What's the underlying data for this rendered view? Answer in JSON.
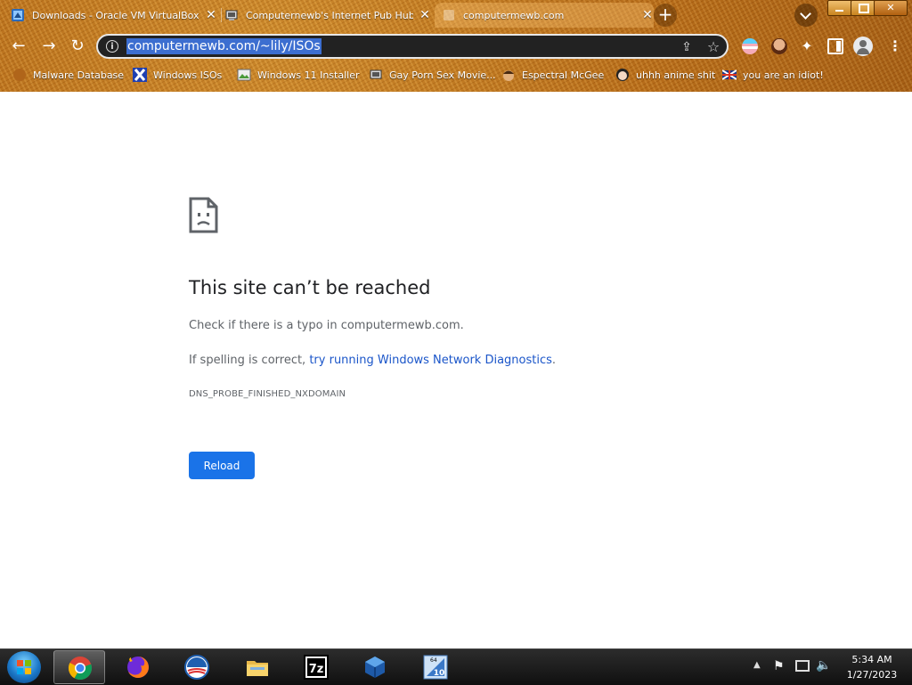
{
  "tabs": [
    {
      "title": "Downloads - Oracle VM VirtualBox",
      "close": "✕"
    },
    {
      "title": "Computernewb's Internet Pub Hub",
      "close": "✕"
    },
    {
      "title": "computermewb.com",
      "close": "✕"
    }
  ],
  "new_tab_label": "+",
  "toolbar": {
    "back": "←",
    "forward": "→",
    "reload": "↻",
    "url": "computermewb.com/~lily/ISOs",
    "site_info": "i",
    "share": "⇪",
    "star": "☆",
    "extensions": "✦",
    "menu": "⋮"
  },
  "bookmarks": [
    {
      "label": "Malware Database",
      "icon": "chrome-logo"
    },
    {
      "label": "Windows ISOs",
      "icon": "x-logo"
    },
    {
      "label": "Windows 11 Installer",
      "icon": "image-icon"
    },
    {
      "label": "Gay Porn Sex Movie...",
      "icon": "pub-hub-icon"
    },
    {
      "label": "Espectral McGee",
      "icon": "face-icon"
    },
    {
      "label": "uhhh anime shit",
      "icon": "anime-icon"
    },
    {
      "label": "you are an idiot!",
      "icon": "uk-flag-icon"
    }
  ],
  "error": {
    "title": "This site can’t be reached",
    "line1": "Check if there is a typo in computermewb.com.",
    "line2_prefix": "If spelling is correct, ",
    "line2_link": "try running Windows Network Diagnostics",
    "line2_suffix": ".",
    "code": "DNS_PROBE_FINISHED_NXDOMAIN",
    "reload_button": "Reload"
  },
  "taskbar": {
    "apps": [
      "chrome-icon",
      "firefox-icon",
      "obama-icon",
      "file-explorer-icon",
      "7zip-icon",
      "virtualbox-icon",
      "windows10-vm-icon"
    ],
    "seven_zip_label": "7z",
    "win10_badge": "10",
    "win10_64": "64",
    "tray_chevron": "▲",
    "tray_flag": "⚑",
    "tray_volume": "🔈",
    "time": "5:34 AM",
    "date": "1/27/2023"
  },
  "colors": {
    "theme": "#c07a1f",
    "link": "#1a55c9",
    "button": "#1a73e8",
    "url_highlight": "#3c6ed0"
  }
}
